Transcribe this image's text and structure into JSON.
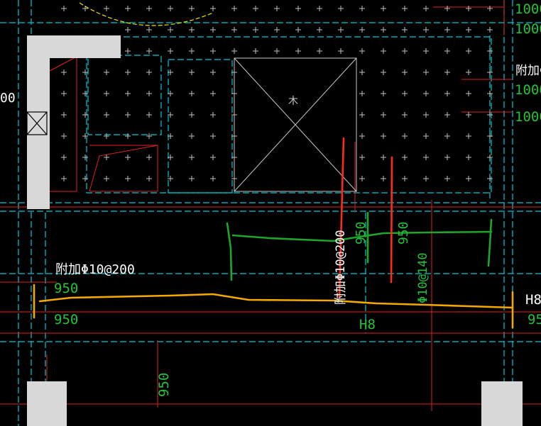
{
  "colors": {
    "background": "#000000",
    "grid_dash": "#00c8d8",
    "rebar_red": "#e02020",
    "column_fill": "#d8d8d8",
    "text_white": "#ffffff",
    "text_green": "#22c33a",
    "markup_yellow": "#f5a800",
    "markup_green": "#1fa52a",
    "markup_red": "#ff2a1a",
    "arc_yellow": "#e6e600"
  },
  "icons": [
    "cross-box-icon",
    "plus-marker-icon"
  ],
  "labels": {
    "rebar_top_left": "附加Φ10@200",
    "dim_950_upper": "950",
    "dim_950_lower": "950",
    "dim_950_bottom": "950",
    "dim_left_edge": "00",
    "rebar_mid_vertical": "附加Φ10@200",
    "dim_950_mid_a": "950",
    "dim_950_mid_b": "950",
    "rebar_right_vertical": "Φ10@140",
    "beam_h8_center": "H8",
    "beam_h8_right": "H8",
    "dim_95_right": "95",
    "rebar_right_edge": "附加Φ",
    "dim_1000_a": "1000",
    "dim_1000_b": "1000",
    "dim_1000_c": "1000",
    "dim_1000_d": "1000",
    "opening_mark": "木"
  }
}
